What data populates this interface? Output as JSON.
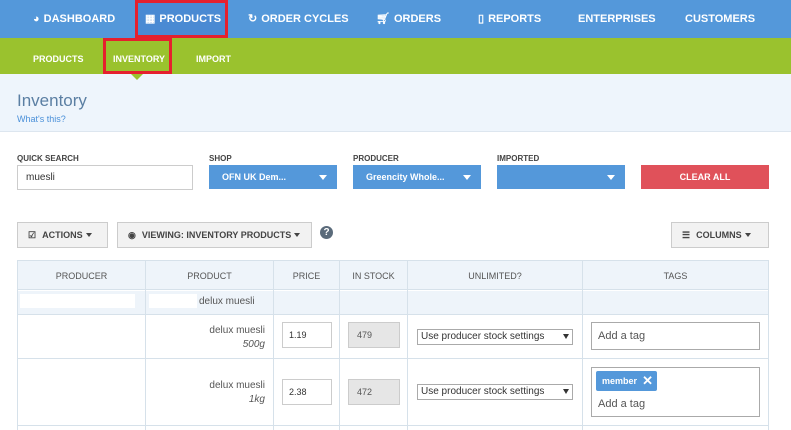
{
  "topnav": {
    "items": [
      {
        "label": "DASHBOARD",
        "icon": "dashboard-icon"
      },
      {
        "label": "PRODUCTS",
        "icon": "products-grid-icon"
      },
      {
        "label": "ORDER CYCLES",
        "icon": "refresh-icon"
      },
      {
        "label": "ORDERS",
        "icon": "cart-icon"
      },
      {
        "label": "REPORTS",
        "icon": "file-icon"
      },
      {
        "label": "ENTERPRISES"
      },
      {
        "label": "CUSTOMERS"
      }
    ]
  },
  "subnav": {
    "items": [
      {
        "label": "PRODUCTS"
      },
      {
        "label": "INVENTORY"
      },
      {
        "label": "IMPORT"
      }
    ]
  },
  "page": {
    "title": "Inventory",
    "subtitle": "What's this?"
  },
  "filters": {
    "quick_search_label": "QUICK SEARCH",
    "quick_search_value": "muesli",
    "shop_label": "SHOP",
    "shop_value": "OFN UK Dem...",
    "producer_label": "PRODUCER",
    "producer_value": "Greencity Whole...",
    "imported_label": "IMPORTED",
    "imported_value": "",
    "clear_all": "CLEAR ALL"
  },
  "toolbar": {
    "actions": "ACTIONS",
    "viewing": "VIEWING: INVENTORY PRODUCTS",
    "help": "?",
    "columns": "COLUMNS"
  },
  "table": {
    "headers": [
      "PRODUCER",
      "PRODUCT",
      "PRICE",
      "IN STOCK",
      "UNLIMITED?",
      "TAGS"
    ],
    "group_product": "delux muesli",
    "rows": [
      {
        "product": "delux muesli",
        "variant": "500g",
        "price": "1.19",
        "stock": "479",
        "unlimited": "Use producer stock settings",
        "tags": [],
        "tag_placeholder": "Add a tag"
      },
      {
        "product": "delux muesli",
        "variant": "1kg",
        "price": "2.38",
        "stock": "472",
        "unlimited": "Use producer stock settings",
        "tags": [
          "member"
        ],
        "tag_placeholder": "Add a tag"
      }
    ]
  },
  "colors": {
    "topnav": "#5498da",
    "subnav": "#9ac22e",
    "highlight": "#e5202e",
    "clear_all": "#e0515a"
  }
}
